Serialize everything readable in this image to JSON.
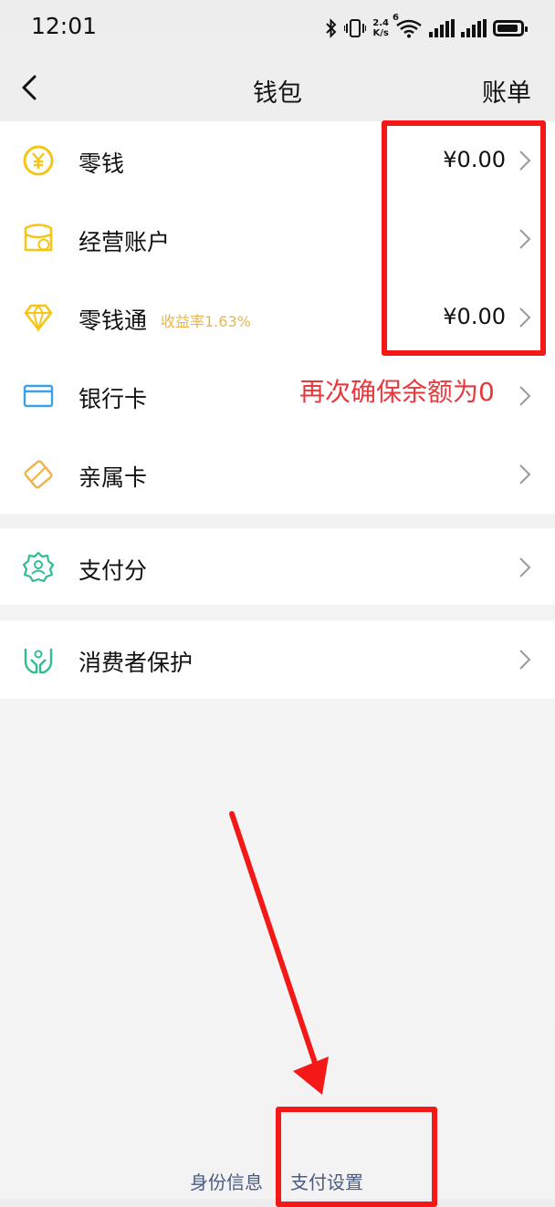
{
  "status_bar": {
    "time": "12:01",
    "net_speed_value": "2.4",
    "net_speed_unit": "K/s",
    "wifi_badge": "6"
  },
  "nav": {
    "title": "钱包",
    "bill_label": "账单"
  },
  "wallet_items": [
    {
      "label": "零钱",
      "amount": "¥0.00",
      "icon": "yen-coin-icon",
      "color": "#f5c518"
    },
    {
      "label": "经营账户",
      "amount": "",
      "icon": "business-account-icon",
      "color": "#f5c518"
    },
    {
      "label": "零钱通",
      "tag": "收益率1.63%",
      "amount": "¥0.00",
      "icon": "diamond-icon",
      "color": "#f5c518"
    },
    {
      "label": "银行卡",
      "amount": "",
      "icon": "bank-card-icon",
      "color": "#3aa0e8"
    },
    {
      "label": "亲属卡",
      "amount": "",
      "icon": "family-card-icon",
      "color": "#f0b24a"
    }
  ],
  "pay_score": {
    "label": "支付分",
    "icon": "pay-score-badge-icon",
    "color": "#2fbf8f"
  },
  "consumer_protection": {
    "label": "消费者保护",
    "icon": "protection-hands-icon",
    "color": "#2fbf8f"
  },
  "annotation": {
    "note": "再次确保余额为0",
    "color": "#f51818"
  },
  "footer": {
    "identity_label": "身份信息",
    "payment_settings_label": "支付设置"
  }
}
